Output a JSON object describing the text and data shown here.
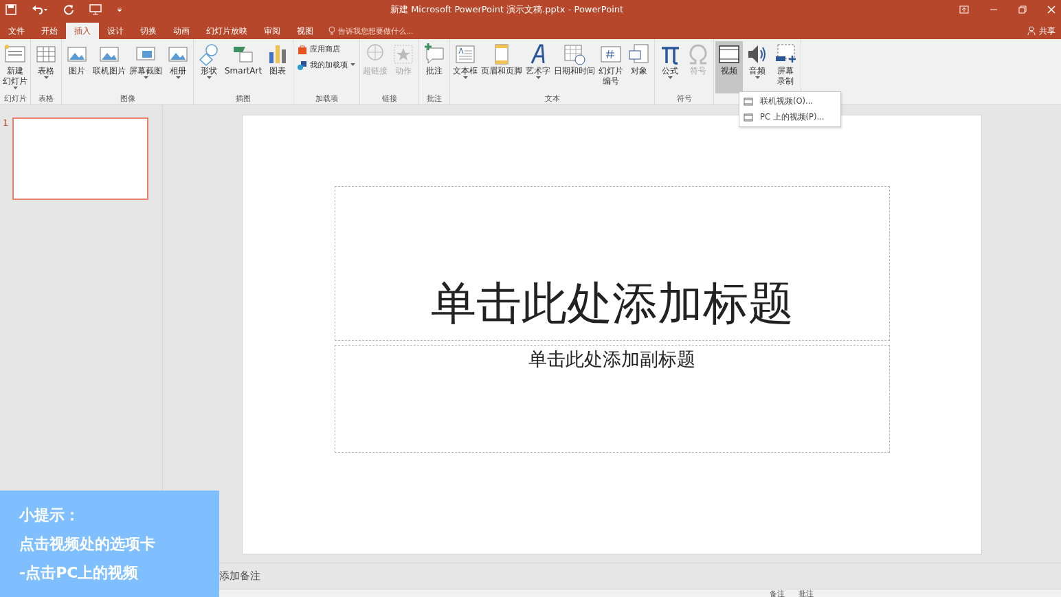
{
  "window": {
    "title": "新建 Microsoft PowerPoint 演示文稿.pptx - PowerPoint"
  },
  "tabs": [
    {
      "label": "文件",
      "selected": false
    },
    {
      "label": "开始",
      "selected": false
    },
    {
      "label": "插入",
      "selected": true
    },
    {
      "label": "设计",
      "selected": false
    },
    {
      "label": "切换",
      "selected": false
    },
    {
      "label": "动画",
      "selected": false
    },
    {
      "label": "幻灯片放映",
      "selected": false
    },
    {
      "label": "审阅",
      "selected": false
    },
    {
      "label": "视图",
      "selected": false
    }
  ],
  "tell_me": {
    "placeholder": "告诉我您想要做什么..."
  },
  "share": {
    "label": "共享"
  },
  "ribbon": [
    {
      "label": "幻灯片",
      "buttons": [
        {
          "kind": "slide",
          "lines": [
            "新建",
            "幻灯片"
          ],
          "dropdown": true,
          "disabled": false,
          "selected": false
        }
      ]
    },
    {
      "label": "表格",
      "buttons": [
        {
          "kind": "table",
          "lines": [
            "表格"
          ],
          "dropdown": true,
          "disabled": false,
          "selected": false
        }
      ]
    },
    {
      "label": "图像",
      "buttons": [
        {
          "kind": "image",
          "lines": [
            "图片"
          ],
          "dropdown": false,
          "disabled": false,
          "selected": false
        },
        {
          "kind": "image",
          "lines": [
            "联机图片"
          ],
          "dropdown": false,
          "disabled": false,
          "selected": false
        },
        {
          "kind": "screen",
          "lines": [
            "屏幕截图"
          ],
          "dropdown": true,
          "disabled": false,
          "selected": false
        },
        {
          "kind": "image",
          "lines": [
            "相册"
          ],
          "dropdown": true,
          "disabled": false,
          "selected": false
        }
      ]
    },
    {
      "label": "插图",
      "buttons": [
        {
          "kind": "shapes",
          "lines": [
            "形状"
          ],
          "dropdown": true,
          "disabled": false,
          "selected": false
        },
        {
          "kind": "smartart",
          "lines": [
            "SmartArt"
          ],
          "dropdown": false,
          "disabled": false,
          "selected": false
        },
        {
          "kind": "chart",
          "lines": [
            "图表"
          ],
          "dropdown": false,
          "disabled": false,
          "selected": false
        }
      ]
    },
    {
      "label": "加载项",
      "small": [
        {
          "kind": "store",
          "label": "应用商店",
          "dropdown": false
        },
        {
          "kind": "addin",
          "label": "我的加载项",
          "dropdown": true
        }
      ]
    },
    {
      "label": "链接",
      "buttons": [
        {
          "kind": "link",
          "lines": [
            "超链接"
          ],
          "dropdown": false,
          "disabled": true,
          "selected": false
        },
        {
          "kind": "star",
          "lines": [
            "动作"
          ],
          "dropdown": false,
          "disabled": true,
          "selected": false
        }
      ]
    },
    {
      "label": "批注",
      "buttons": [
        {
          "kind": "comment",
          "lines": [
            "批注"
          ],
          "dropdown": false,
          "disabled": false,
          "selected": false
        }
      ]
    },
    {
      "label": "文本",
      "buttons": [
        {
          "kind": "textbox",
          "lines": [
            "文本框"
          ],
          "dropdown": true,
          "disabled": false,
          "selected": false
        },
        {
          "kind": "page",
          "lines": [
            "页眉和页脚"
          ],
          "dropdown": false,
          "disabled": false,
          "selected": false
        },
        {
          "kind": "wordart",
          "lines": [
            "艺术字"
          ],
          "dropdown": true,
          "disabled": false,
          "selected": false
        },
        {
          "kind": "calendar",
          "lines": [
            "日期和时间"
          ],
          "dropdown": false,
          "disabled": false,
          "selected": false
        },
        {
          "kind": "number",
          "lines": [
            "幻灯片",
            "编号"
          ],
          "dropdown": false,
          "disabled": false,
          "selected": false
        },
        {
          "kind": "object",
          "lines": [
            "对象"
          ],
          "dropdown": false,
          "disabled": false,
          "selected": false
        }
      ]
    },
    {
      "label": "符号",
      "buttons": [
        {
          "kind": "pi",
          "lines": [
            "公式"
          ],
          "dropdown": true,
          "disabled": false,
          "selected": false
        },
        {
          "kind": "omega",
          "lines": [
            "符号"
          ],
          "dropdown": false,
          "disabled": true,
          "selected": false
        }
      ]
    },
    {
      "buttons": [
        {
          "kind": "film",
          "lines": [
            "视频"
          ],
          "dropdown": false,
          "disabled": false,
          "selected": true
        },
        {
          "kind": "speaker",
          "lines": [
            "音频"
          ],
          "dropdown": true,
          "disabled": false,
          "selected": false
        },
        {
          "kind": "record",
          "lines": [
            "屏幕",
            "录制"
          ],
          "dropdown": false,
          "disabled": false,
          "selected": false
        }
      ]
    }
  ],
  "video_menu": [
    {
      "label": "联机视频(O)..."
    },
    {
      "label": "PC 上的视频(P)..."
    }
  ],
  "thumbnails": [
    {
      "number": "1",
      "selected": true
    }
  ],
  "slide": {
    "title_placeholder": "单击此处添加标题",
    "subtitle_placeholder": "单击此处添加副标题"
  },
  "notes": {
    "placeholder": "添加备注"
  },
  "status_bar": [
    {
      "label": "备注"
    },
    {
      "label": "批注"
    }
  ],
  "tip": {
    "lines": [
      "小提示：",
      "点击视频处的选项卡",
      "-点击PC上的视频"
    ]
  }
}
